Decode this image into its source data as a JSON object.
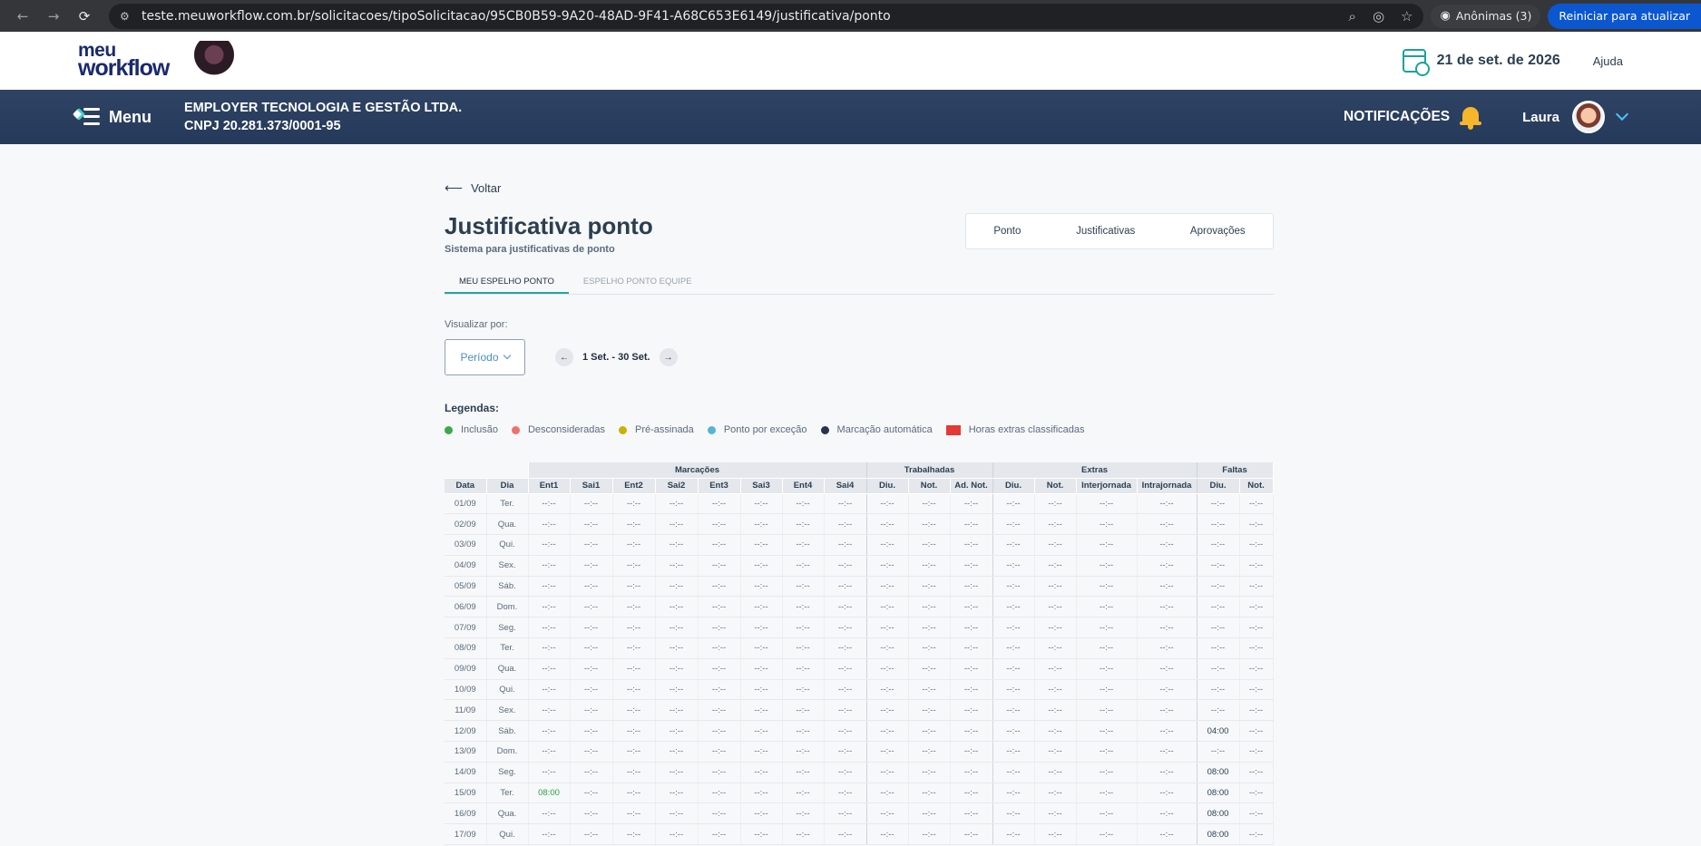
{
  "browser": {
    "url": "teste.meuworkflow.com.br/solicitacoes/tipoSolicitacao/95CB0B59-9A20-48AD-9F41-A68C653E6149/justificativa/ponto",
    "incognito_label": "Anônimas (3)",
    "update_label": "Reiniciar para atualizar"
  },
  "header": {
    "logo_line1": "meu",
    "logo_line2": "workflow",
    "date": "21 de set. de 2026",
    "help": "Ajuda"
  },
  "navbar": {
    "menu_label": "Menu",
    "company_name": "EMPLOYER TECNOLOGIA E GESTÃO LTDA.",
    "company_cnpj": "CNPJ 20.281.373/0001-95",
    "notifications_label": "NOTIFICAÇÕES",
    "user_name": "Laura"
  },
  "page": {
    "back_label": "Voltar",
    "title": "Justificativa ponto",
    "subtitle": "Sistema para justificativas de ponto",
    "quick_tabs": [
      "Ponto",
      "Justificativas",
      "Aprovações"
    ],
    "tabs": [
      "MEU ESPELHO PONTO",
      "ESPELHO PONTO EQUIPE"
    ],
    "view_by_label": "Visualizar por:",
    "period_select": "Período",
    "range": "1 Set. - 30 Set.",
    "legend_title": "Legendas:",
    "legend": [
      {
        "label": "Inclusão",
        "color": "#3aa94a"
      },
      {
        "label": "Desconsideradas",
        "color": "#ef6f6a"
      },
      {
        "label": "Pré-assinada",
        "color": "#c9b200"
      },
      {
        "label": "Ponto por exceção",
        "color": "#55b4d8"
      },
      {
        "label": "Marcação automática",
        "color": "#243552"
      },
      {
        "label": "Horas extras classificadas",
        "color": "#e53935"
      }
    ]
  },
  "table": {
    "groups": [
      "Marcações",
      "Trabalhadas",
      "Extras",
      "Faltas"
    ],
    "columns": [
      "Data",
      "Dia",
      "Ent1",
      "Sai1",
      "Ent2",
      "Sai2",
      "Ent3",
      "Sai3",
      "Ent4",
      "Sai4",
      "Diu.",
      "Not.",
      "Ad. Not.",
      "Diu.",
      "Not.",
      "Interjornada",
      "Intrajornada",
      "Diu.",
      "Not."
    ],
    "empty": "--:--",
    "rows": [
      {
        "date": "01/09",
        "day": "Ter.",
        "cells": {}
      },
      {
        "date": "02/09",
        "day": "Qua.",
        "cells": {}
      },
      {
        "date": "03/09",
        "day": "Qui.",
        "cells": {}
      },
      {
        "date": "04/09",
        "day": "Sex.",
        "cells": {}
      },
      {
        "date": "05/09",
        "day": "Sáb.",
        "cells": {}
      },
      {
        "date": "06/09",
        "day": "Dom.",
        "cells": {}
      },
      {
        "date": "07/09",
        "day": "Seg.",
        "cells": {}
      },
      {
        "date": "08/09",
        "day": "Ter.",
        "cells": {}
      },
      {
        "date": "09/09",
        "day": "Qua.",
        "cells": {}
      },
      {
        "date": "10/09",
        "day": "Qui.",
        "cells": {}
      },
      {
        "date": "11/09",
        "day": "Sex.",
        "cells": {}
      },
      {
        "date": "12/09",
        "day": "Sáb.",
        "cells": {
          "17": "04:00"
        }
      },
      {
        "date": "13/09",
        "day": "Dom.",
        "cells": {}
      },
      {
        "date": "14/09",
        "day": "Seg.",
        "cells": {
          "17": "08:00"
        }
      },
      {
        "date": "15/09",
        "day": "Ter.",
        "cells": {
          "2": "08:00",
          "17": "08:00"
        }
      },
      {
        "date": "16/09",
        "day": "Qua.",
        "cells": {
          "17": "08:00"
        }
      },
      {
        "date": "17/09",
        "day": "Qui.",
        "cells": {
          "17": "08:00"
        }
      }
    ]
  }
}
